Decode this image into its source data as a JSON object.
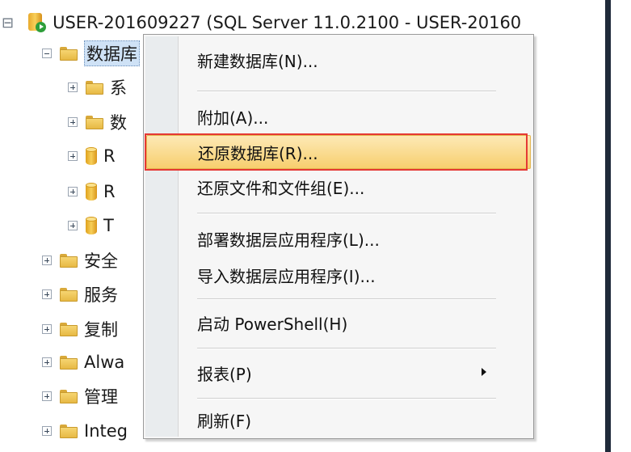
{
  "tree": {
    "server_label": "USER-201609227 (SQL Server 11.0.2100 - USER-20160",
    "nodes": [
      {
        "label": "数据库",
        "icon": "folder-icon"
      },
      {
        "label": "系",
        "icon": "folder-icon"
      },
      {
        "label": "数",
        "icon": "folder-icon"
      },
      {
        "label": "R",
        "icon": "database-icon"
      },
      {
        "label": "R",
        "icon": "database-icon"
      },
      {
        "label": "T",
        "icon": "database-icon"
      },
      {
        "label": "安全",
        "icon": "folder-icon"
      },
      {
        "label": "服务",
        "icon": "folder-icon"
      },
      {
        "label": "复制",
        "icon": "folder-icon"
      },
      {
        "label": "Alwa",
        "icon": "folder-icon"
      },
      {
        "label": "管理",
        "icon": "folder-icon"
      },
      {
        "label": "Integ",
        "icon": "folder-icon"
      }
    ]
  },
  "context_menu": {
    "items": [
      {
        "label": "新建数据库(N)..."
      },
      {
        "label": "附加(A)..."
      },
      {
        "label": "还原数据库(R)..."
      },
      {
        "label": "还原文件和文件组(E)..."
      },
      {
        "label": "部署数据层应用程序(L)..."
      },
      {
        "label": "导入数据层应用程序(I)..."
      },
      {
        "label": "启动 PowerShell(H)"
      },
      {
        "label": "报表(P)"
      },
      {
        "label": "刷新(F)"
      }
    ]
  },
  "colors": {
    "highlight": "#f7cf6e",
    "annotation": "#e53935",
    "selection": "#cfe2f6"
  }
}
